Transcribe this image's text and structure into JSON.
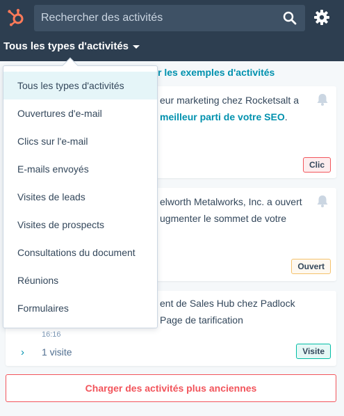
{
  "header": {
    "logo_icon": "hubspot-sprocket-icon",
    "search_placeholder": "Rechercher des activités",
    "search_icon": "search-icon",
    "settings_icon": "gear-icon",
    "type_filter_label": "Tous les types d'activités"
  },
  "main": {
    "examples_link": "r les exemples d'activités",
    "cards": [
      {
        "line1": "eur marketing chez Rocketsalt a",
        "line2_link": "meilleur parti de votre SEO",
        "line2_suffix": ".",
        "tag": "Clic"
      },
      {
        "line1": "elworth Metalworks, Inc. a ouvert",
        "line2": "ugmenter le sommet de votre",
        "tag": "Ouvert"
      },
      {
        "line1": "ent de Sales Hub chez Padlock",
        "line2": "Page de tarification",
        "time": "16:16",
        "expand_icon": "chevron-right-icon",
        "visits": "1 visite",
        "tag": "Visite"
      }
    ],
    "load_more": "Charger des activités plus anciennes"
  },
  "dropdown": {
    "items": [
      "Tous les types d'activités",
      "Ouvertures d'e-mail",
      "Clics sur l'e-mail",
      "E-mails envoyés",
      "Visites de leads",
      "Visites de prospects",
      "Consultations du document",
      "Réunions",
      "Formulaires"
    ],
    "selected_index": 0
  },
  "colors": {
    "nav_bg": "#2d3e50",
    "accent_orange": "#ff7a59",
    "link": "#0091ae",
    "load_more": "#f2545b"
  }
}
